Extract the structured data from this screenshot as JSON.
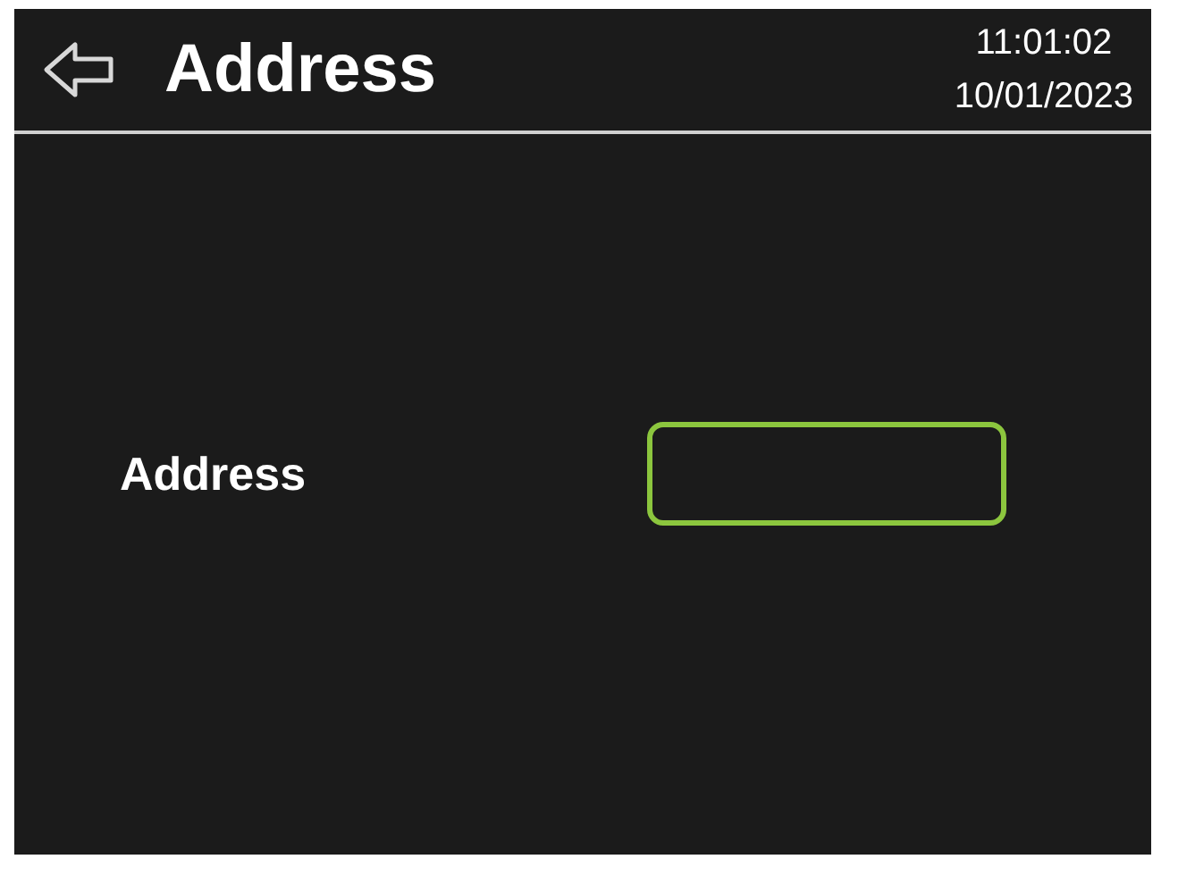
{
  "header": {
    "title": "Address",
    "time": "11:01:02",
    "date": "10/01/2023"
  },
  "field": {
    "label": "Address",
    "focused": true
  }
}
